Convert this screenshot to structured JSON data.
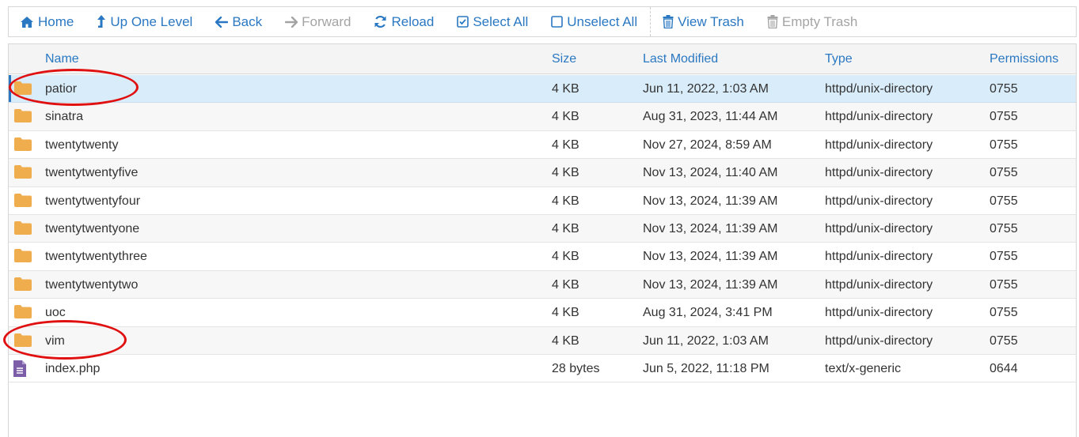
{
  "toolbar": {
    "home": "Home",
    "up": "Up One Level",
    "back": "Back",
    "forward": "Forward",
    "reload": "Reload",
    "select_all": "Select All",
    "unselect_all": "Unselect All",
    "view_trash": "View Trash",
    "empty_trash": "Empty Trash"
  },
  "table": {
    "headers": {
      "name": "Name",
      "size": "Size",
      "modified": "Last Modified",
      "type": "Type",
      "permissions": "Permissions"
    },
    "rows": [
      {
        "name": "patior",
        "size": "4 KB",
        "modified": "Jun 11, 2022, 1:03 AM",
        "type": "httpd/unix-directory",
        "perm": "0755",
        "kind": "folder"
      },
      {
        "name": "sinatra",
        "size": "4 KB",
        "modified": "Aug 31, 2023, 11:44 AM",
        "type": "httpd/unix-directory",
        "perm": "0755",
        "kind": "folder"
      },
      {
        "name": "twentytwenty",
        "size": "4 KB",
        "modified": "Nov 27, 2024, 8:59 AM",
        "type": "httpd/unix-directory",
        "perm": "0755",
        "kind": "folder"
      },
      {
        "name": "twentytwentyfive",
        "size": "4 KB",
        "modified": "Nov 13, 2024, 11:40 AM",
        "type": "httpd/unix-directory",
        "perm": "0755",
        "kind": "folder"
      },
      {
        "name": "twentytwentyfour",
        "size": "4 KB",
        "modified": "Nov 13, 2024, 11:39 AM",
        "type": "httpd/unix-directory",
        "perm": "0755",
        "kind": "folder"
      },
      {
        "name": "twentytwentyone",
        "size": "4 KB",
        "modified": "Nov 13, 2024, 11:39 AM",
        "type": "httpd/unix-directory",
        "perm": "0755",
        "kind": "folder"
      },
      {
        "name": "twentytwentythree",
        "size": "4 KB",
        "modified": "Nov 13, 2024, 11:39 AM",
        "type": "httpd/unix-directory",
        "perm": "0755",
        "kind": "folder"
      },
      {
        "name": "twentytwentytwo",
        "size": "4 KB",
        "modified": "Nov 13, 2024, 11:39 AM",
        "type": "httpd/unix-directory",
        "perm": "0755",
        "kind": "folder"
      },
      {
        "name": "uoc",
        "size": "4 KB",
        "modified": "Aug 31, 2024, 3:41 PM",
        "type": "httpd/unix-directory",
        "perm": "0755",
        "kind": "folder"
      },
      {
        "name": "vim",
        "size": "4 KB",
        "modified": "Jun 11, 2022, 1:03 AM",
        "type": "httpd/unix-directory",
        "perm": "0755",
        "kind": "folder"
      },
      {
        "name": "index.php",
        "size": "28 bytes",
        "modified": "Jun 5, 2022, 11:18 PM",
        "type": "text/x-generic",
        "perm": "0644",
        "kind": "file"
      }
    ]
  },
  "colors": {
    "accent": "#2a78c2",
    "folder": "#f0ad4e",
    "file": "#7b5ea7",
    "selected_row": "#d9ecf9",
    "annotation": "#e01010"
  },
  "icons": {
    "home": "home-icon",
    "up": "level-up-icon",
    "back": "arrow-left-icon",
    "forward": "arrow-right-icon",
    "reload": "refresh-icon",
    "select_all": "checkbox-checked-icon",
    "unselect_all": "checkbox-empty-icon",
    "view_trash": "trash-icon",
    "empty_trash": "trash-icon",
    "folder": "folder-icon",
    "file": "file-text-icon"
  }
}
